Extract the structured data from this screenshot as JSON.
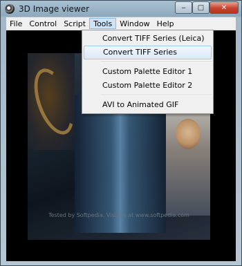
{
  "window": {
    "title": "3D Image viewer"
  },
  "caption_buttons": {
    "minimize": "‒",
    "maximize": "□",
    "close": "✕"
  },
  "menubar": {
    "items": [
      {
        "label": "File"
      },
      {
        "label": "Control"
      },
      {
        "label": "Script"
      },
      {
        "label": "Tools",
        "active": true
      },
      {
        "label": "Window"
      },
      {
        "label": "Help"
      }
    ]
  },
  "tools_menu": {
    "items": [
      {
        "label": "Convert TIFF Series (Leica)"
      },
      {
        "label": "Convert TIFF Series",
        "hovered": true
      },
      {
        "label": "Custom Palette Editor 1"
      },
      {
        "label": "Custom Palette Editor 2"
      },
      {
        "label": "AVI  to Animated GIF"
      }
    ]
  },
  "viewport": {
    "caption": "Tested by Softpedia. Visit us at www.softpedia.com"
  }
}
